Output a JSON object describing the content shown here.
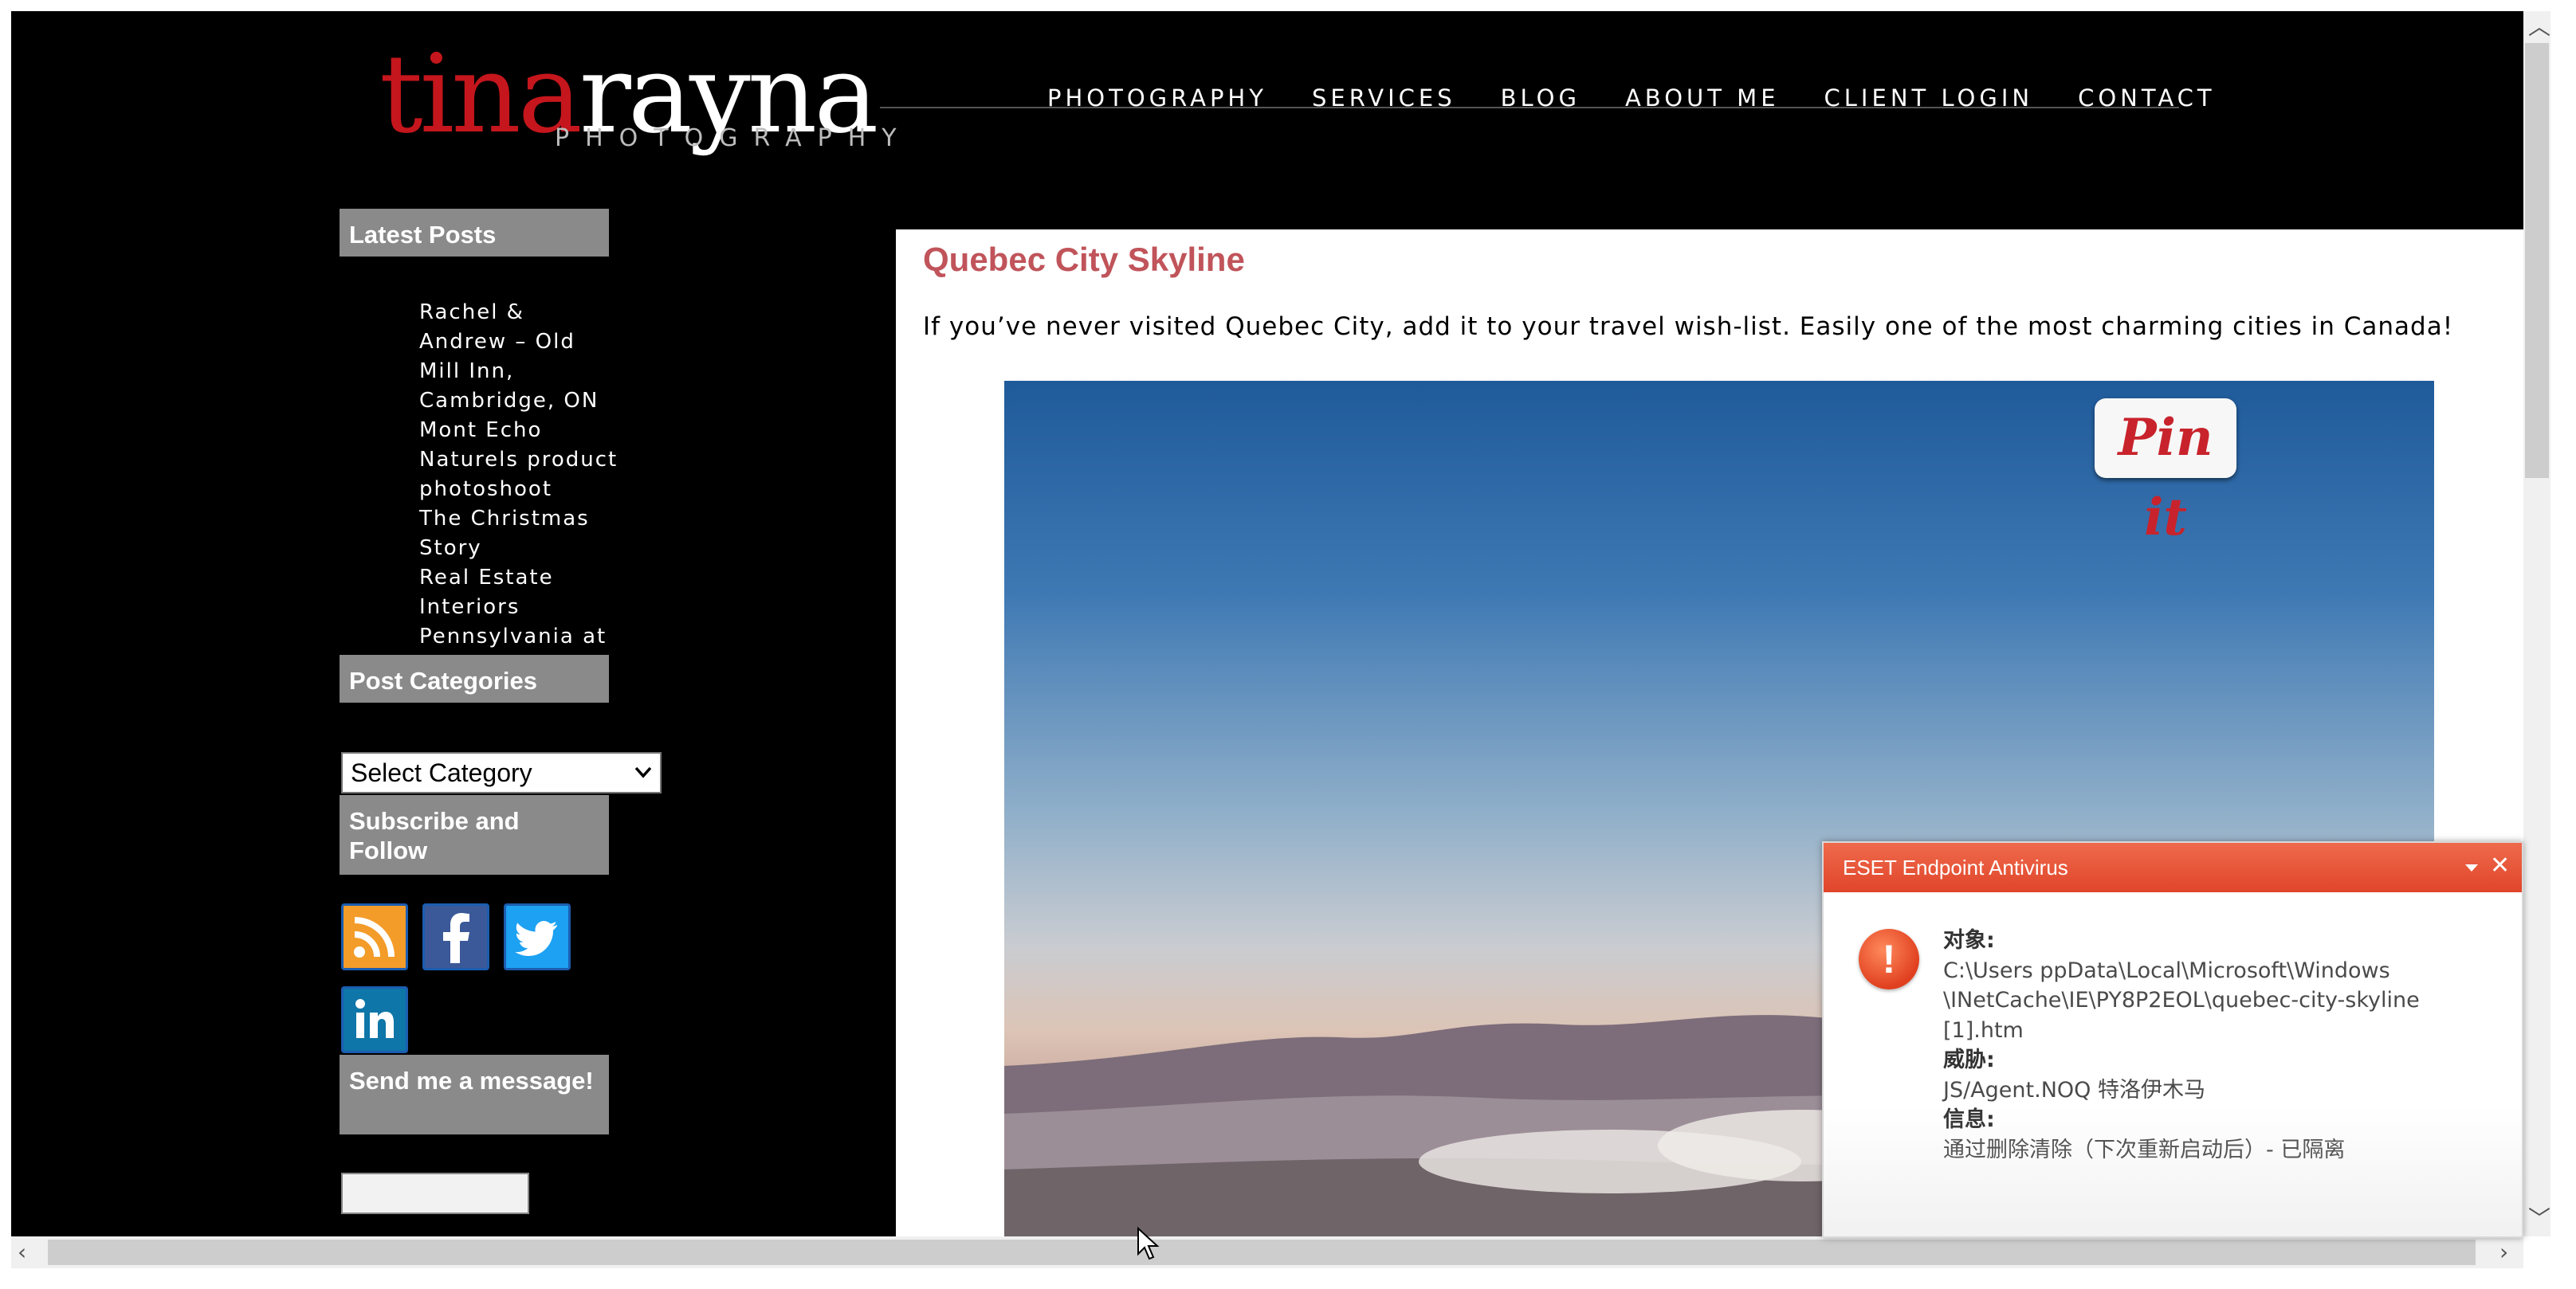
{
  "site": {
    "logo_red": "tina",
    "logo_white": "rayna",
    "logo_tag": "PHOTOGRAPHY",
    "nav": [
      "PHOTOGRAPHY",
      "SERVICES",
      "BLOG",
      "ABOUT ME",
      "CLIENT LOGIN",
      "CONTACT"
    ]
  },
  "sidebar": {
    "latest_posts_title": "Latest Posts",
    "posts": [
      "Rachel & Andrew – Old Mill Inn, Cambridge, ON",
      "Mont Echo Naturels product photoshoot",
      "The Christmas Story",
      "Real Estate Interiors",
      "Pennsylvania at dusk & dawn"
    ],
    "categories_title": "Post Categories",
    "category_select": "Select Category",
    "subscribe_title": "Subscribe and Follow",
    "social_icons": [
      "rss-icon",
      "facebook-icon",
      "twitter-icon",
      "linkedin-icon"
    ],
    "message_title": "Send me a message!"
  },
  "post": {
    "title": "Quebec City Skyline",
    "body": "If you’ve never visited Quebec City, add it to your travel wish-list. Easily one of the most charming cities in Canada!",
    "pin_label": "Pin it"
  },
  "eset": {
    "title": "ESET Endpoint Antivirus",
    "object_label": "对象:",
    "object_value_1": "C:\\Users        ppData\\Local\\Microsoft\\Windows",
    "object_value_2": "\\INetCache\\IE\\PY8P2EOL\\quebec-city-skyline",
    "object_value_3": "[1].htm",
    "threat_label": "威胁:",
    "threat_value": "JS/Agent.NOQ 特洛伊木马",
    "info_label": "信息:",
    "info_value": "通过删除清除（下次重新启动后）- 已隔离"
  },
  "colors": {
    "accent_red": "#c4161c",
    "title_color": "#c0545a",
    "widget_gray": "#8a8a8a",
    "eset_orange": "#e0452a"
  }
}
